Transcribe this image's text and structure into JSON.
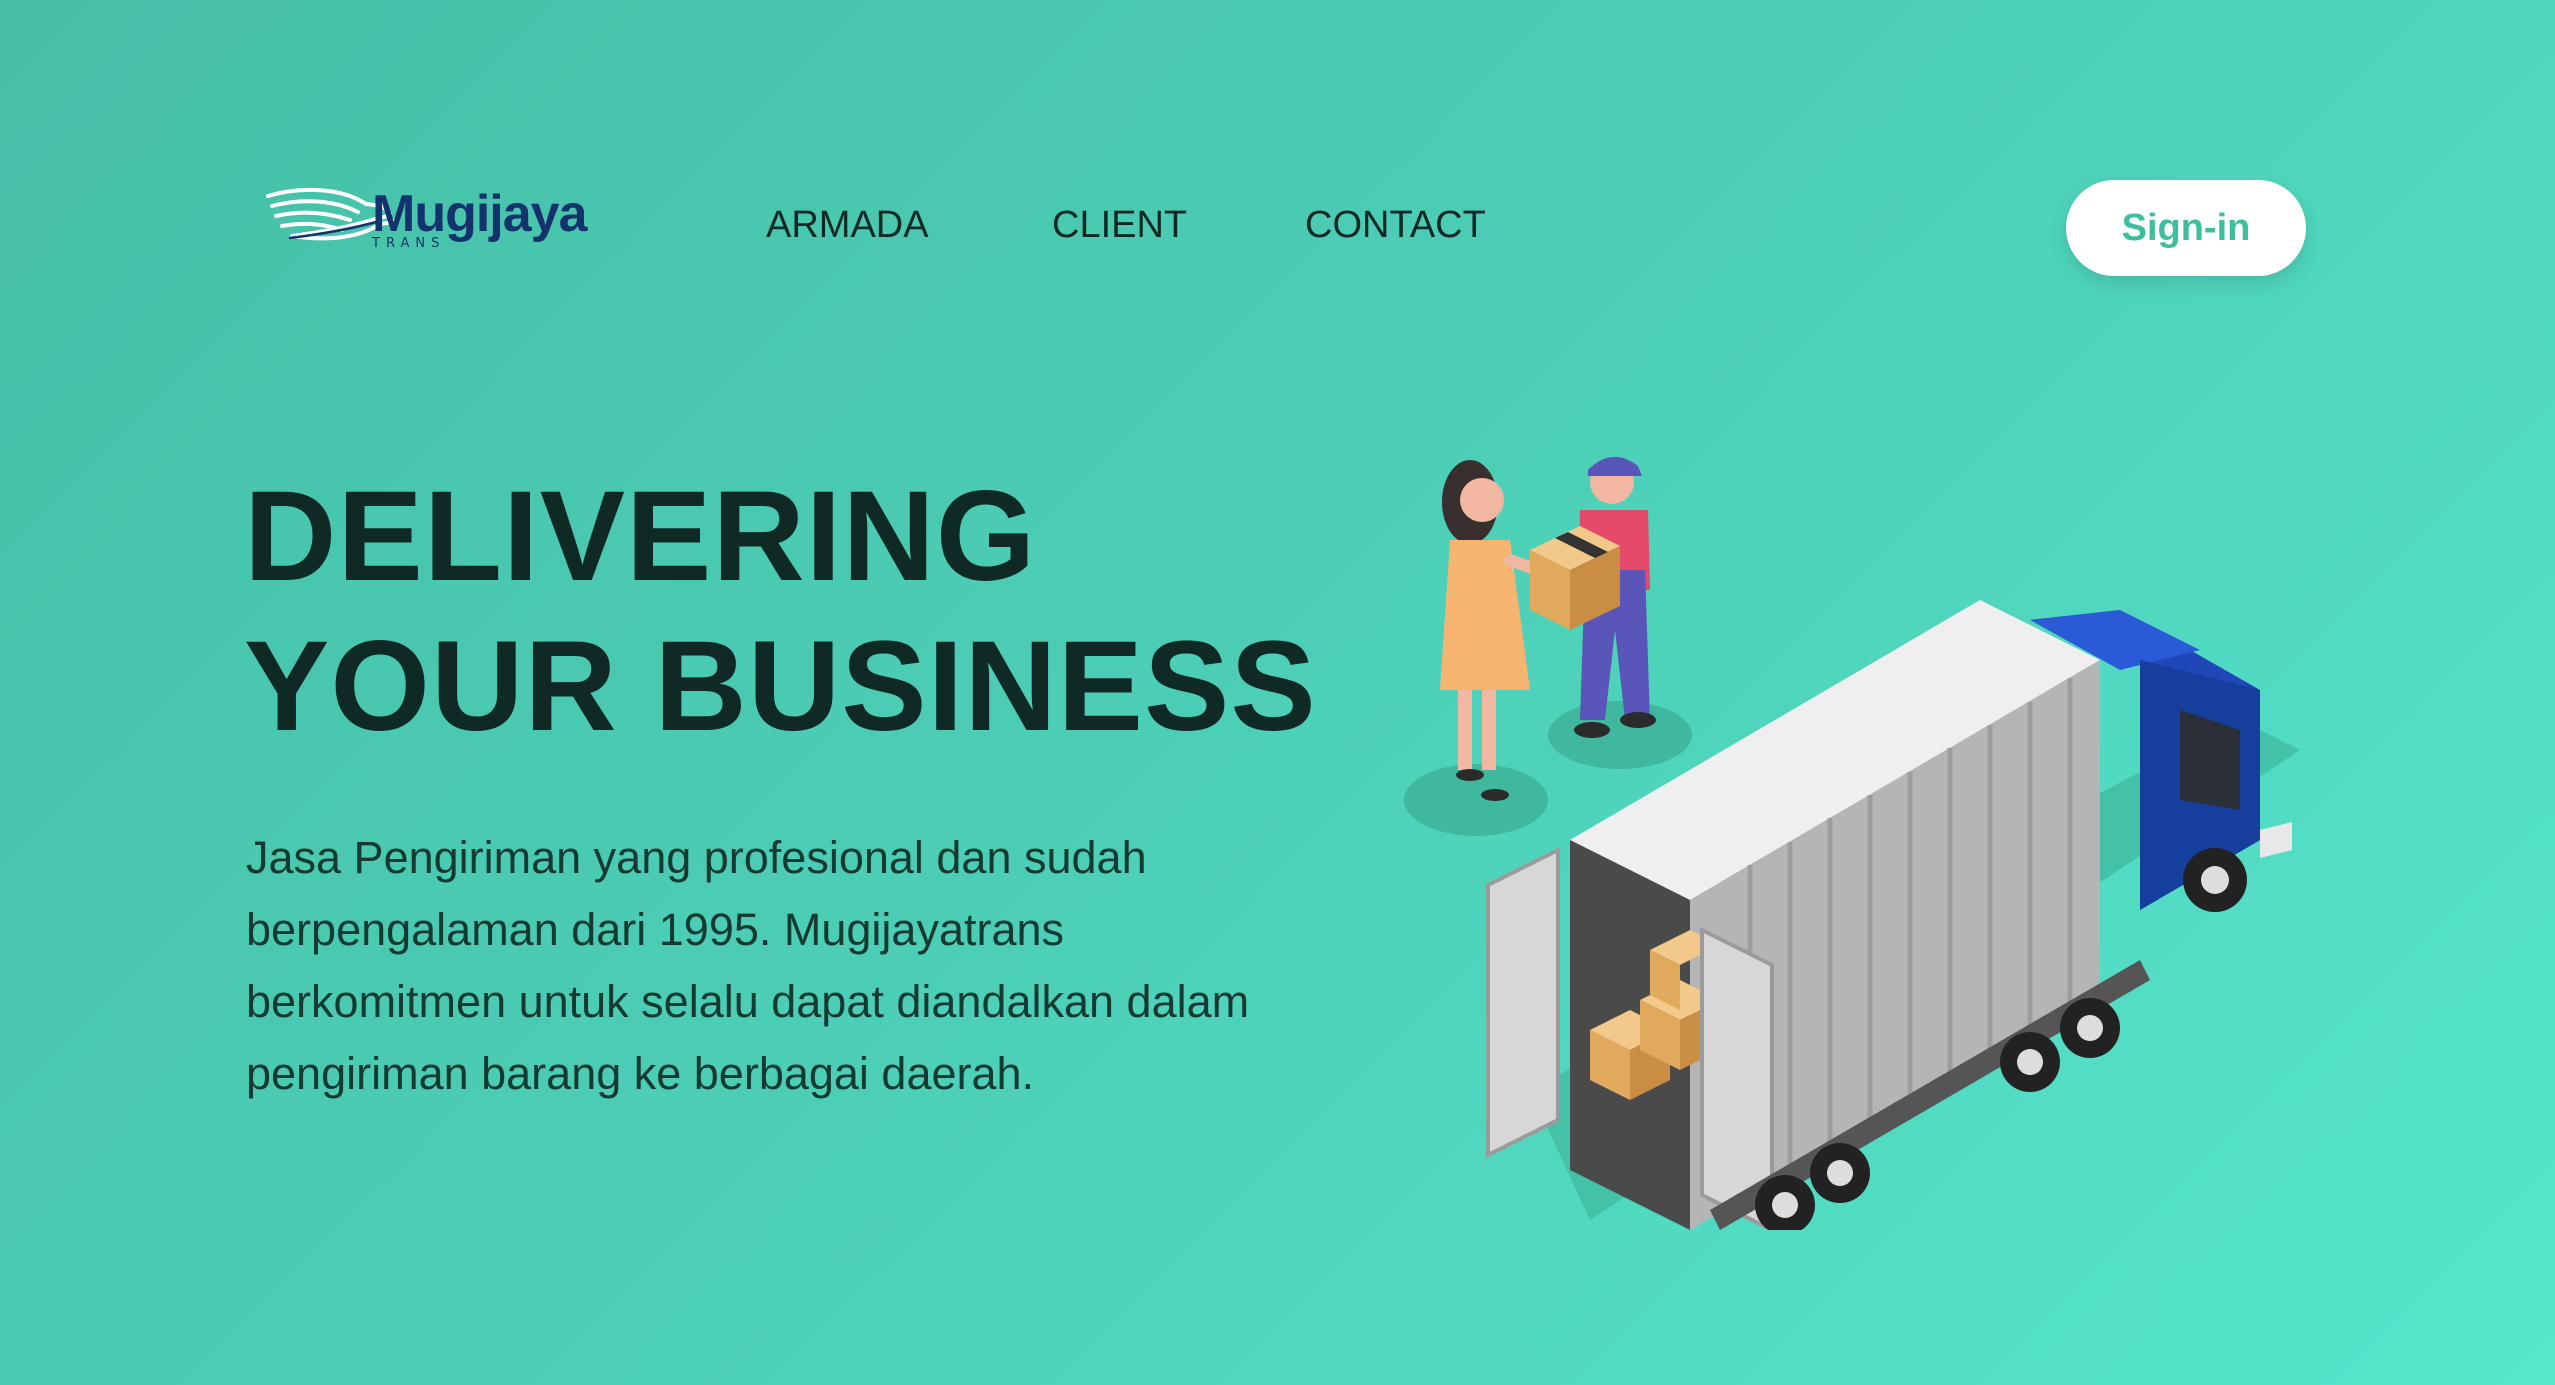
{
  "brand": {
    "name": "Mugijaya",
    "tagline": "TRANS",
    "color": "#14336e"
  },
  "nav": {
    "items": [
      {
        "label": "ARMADA"
      },
      {
        "label": "CLIENT"
      },
      {
        "label": "CONTACT"
      }
    ],
    "signin_label": "Sign-in"
  },
  "hero": {
    "title_line1": "DELIVERING",
    "title_line2": "YOUR BUSINESS",
    "description": "Jasa Pengiriman yang profesional dan sudah berpengalaman dari 1995. Mugijayatrans berkomitmen untuk selalu dapat diandalkan dalam pengiriman barang ke berbagai daerah."
  },
  "colors": {
    "background_start": "#45bfa6",
    "background_end": "#55e6cc",
    "accent": "#3dbf9e",
    "heading": "#0f2a24"
  },
  "icons": {
    "logo": "eagle-wing-icon",
    "illustration": "delivery-truck-illustration"
  }
}
